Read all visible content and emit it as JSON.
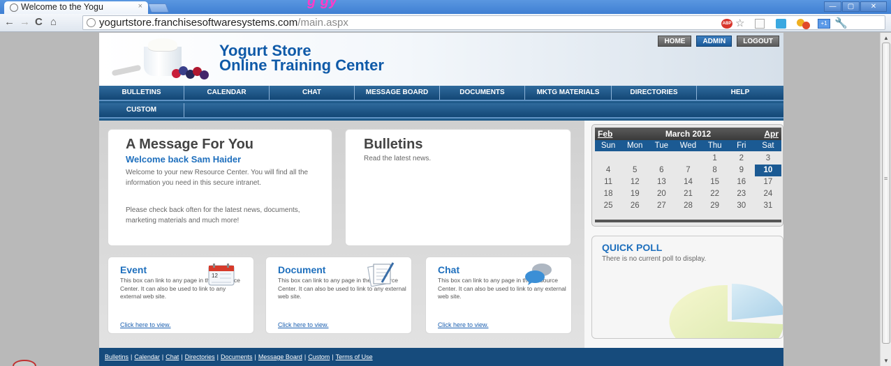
{
  "browser": {
    "tab_title": "Welcome to the Yogu",
    "tab_close": "×",
    "banner_text": "g                            gy",
    "url_host": "yogurtstore.franchisesoftwaresystems.com",
    "url_path": "/main.aspx",
    "window_buttons": [
      "—",
      "▢",
      "✕"
    ],
    "ext_abp": "ABP",
    "ext_sq": "+1"
  },
  "site": {
    "title_line1": "Yogurt Store",
    "title_line2": "Online Training Center",
    "top_links": [
      "HOME",
      "ADMIN",
      "LOGOUT"
    ],
    "nav_row1": [
      "BULLETINS",
      "CALENDAR",
      "CHAT",
      "MESSAGE BOARD",
      "DOCUMENTS",
      "MKTG MATERIALS",
      "DIRECTORIES",
      "HELP"
    ],
    "nav_row2": [
      "CUSTOM"
    ]
  },
  "message": {
    "heading": "A Message For You",
    "welcome": "Welcome back Sam Haider",
    "p1": "Welcome to your new Resource Center. You will find all the information you need in this secure intranet.",
    "p2": "Please check back often for the latest news, documents, marketing materials and much more!"
  },
  "bulletins": {
    "heading": "Bulletins",
    "text": "Read the latest news."
  },
  "boxes": [
    {
      "title": "Event",
      "text": "This box can link to any page in the Resource Center. It can also be used to link to any external web site.",
      "link": "Click here to view.",
      "icon": "calendar-icon"
    },
    {
      "title": "Document",
      "text": "This box can link to any page in the Resource Center. It can also be used to link to any external web site.",
      "link": "Click here to view.",
      "icon": "document-icon"
    },
    {
      "title": "Chat",
      "text": "This box can link to any page in the Resource Center. It can also be used to link to any external web site.",
      "link": "Click here to view.",
      "icon": "chat-bubbles-icon"
    }
  ],
  "calendar": {
    "prev": "Feb",
    "title": "March 2012",
    "next": "Apr",
    "dow": [
      "Sun",
      "Mon",
      "Tue",
      "Wed",
      "Thu",
      "Fri",
      "Sat"
    ],
    "weeks": [
      [
        "",
        "",
        "",
        "",
        "1",
        "2",
        "3"
      ],
      [
        "4",
        "5",
        "6",
        "7",
        "8",
        "9",
        "10"
      ],
      [
        "11",
        "12",
        "13",
        "14",
        "15",
        "16",
        "17"
      ],
      [
        "18",
        "19",
        "20",
        "21",
        "22",
        "23",
        "24"
      ],
      [
        "25",
        "26",
        "27",
        "28",
        "29",
        "30",
        "31"
      ]
    ],
    "today": "10"
  },
  "poll": {
    "title": "QUICK POLL",
    "text": "There is no current poll to display."
  },
  "footer": {
    "links": [
      "Bulletins",
      "Calendar",
      "Chat",
      "Directories",
      "Documents",
      "Message Board",
      "Custom",
      "Terms of Use"
    ]
  },
  "colors": {
    "brand_blue": "#0f5aa8",
    "nav_blue": "#1f5a8a",
    "link_blue": "#1e6fbd",
    "footer_blue": "#164b7c"
  }
}
